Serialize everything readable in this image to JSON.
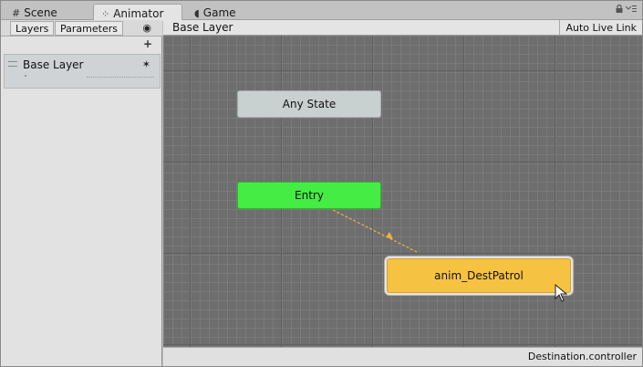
{
  "tabs": [
    {
      "label": "Scene",
      "icon": "grid-icon"
    },
    {
      "label": "Animator",
      "icon": "animator-icon"
    },
    {
      "label": "Game",
      "icon": "pacman-icon"
    }
  ],
  "left_panel": {
    "tabs": [
      "Layers",
      "Parameters"
    ],
    "layers": [
      {
        "name": "Base Layer"
      }
    ]
  },
  "graph": {
    "breadcrumb": "Base Layer",
    "live_link_label": "Auto Live Link",
    "states": {
      "any": "Any State",
      "entry": "Entry",
      "default": "anim_DestPatrol"
    },
    "colors": {
      "any_state": "#c8d0d0",
      "entry_state": "#44ec44",
      "default_state": "#f6c242",
      "transition": "#f0b040"
    }
  },
  "status": {
    "controller_file": "Destination.controller"
  }
}
